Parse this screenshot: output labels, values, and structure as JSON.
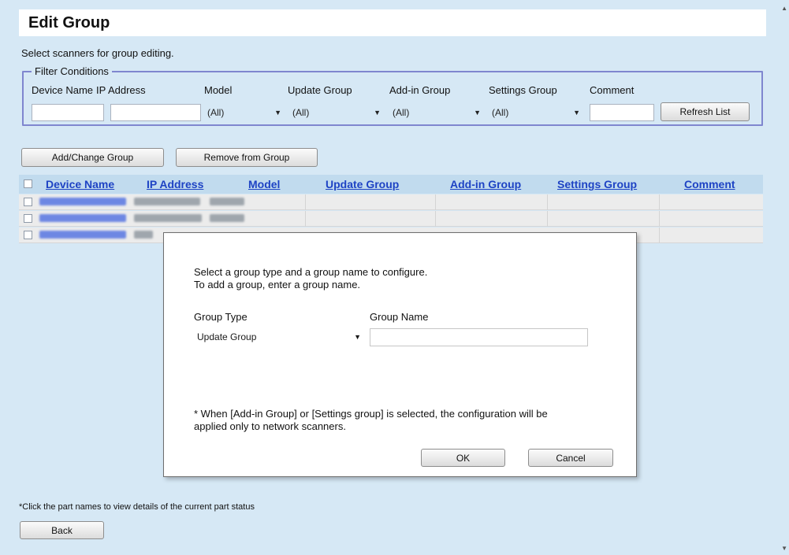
{
  "page": {
    "title": "Edit Group",
    "subtitle": "Select scanners for group editing.",
    "footnote": "*Click the part names to view details of the current part status"
  },
  "filter": {
    "legend": "Filter Conditions",
    "labels": {
      "device_name": "Device Name",
      "ip_address": "IP Address",
      "model": "Model",
      "update_group": "Update Group",
      "addin_group": "Add-in Group",
      "settings_group": "Settings Group",
      "comment": "Comment"
    },
    "values": {
      "device_name": "",
      "ip_address": "",
      "model": "(All)",
      "update_group": "(All)",
      "addin_group": "(All)",
      "settings_group": "(All)",
      "comment": ""
    },
    "refresh_label": "Refresh List"
  },
  "actions": {
    "add_change_label": "Add/Change Group",
    "remove_label": "Remove from Group"
  },
  "table": {
    "columns": [
      "Device Name",
      "IP Address",
      "Model",
      "Update Group",
      "Add-in Group",
      "Settings Group",
      "Comment"
    ],
    "rows_note": "3 rows with blurred device name, IP address and model values"
  },
  "dialog": {
    "instruction_line1": "Select a group type and a group name to configure.",
    "instruction_line2": "To add a group, enter a group name.",
    "group_type_label": "Group Type",
    "group_name_label": "Group Name",
    "group_type_value": "Update Group",
    "group_name_value": "",
    "note_line1": "* When [Add-in Group] or [Settings group] is selected, the configuration will be",
    "note_line2": "applied only to network scanners.",
    "ok_label": "OK",
    "cancel_label": "Cancel"
  },
  "footer": {
    "back_label": "Back"
  },
  "icons": {
    "dropdown": "chevron-down-icon",
    "checkbox": "checkbox-icon"
  },
  "colors": {
    "background": "#d6e8f5",
    "link": "#1e43c4",
    "header_row": "#c1dbee",
    "filter_border": "#7f86cf"
  }
}
